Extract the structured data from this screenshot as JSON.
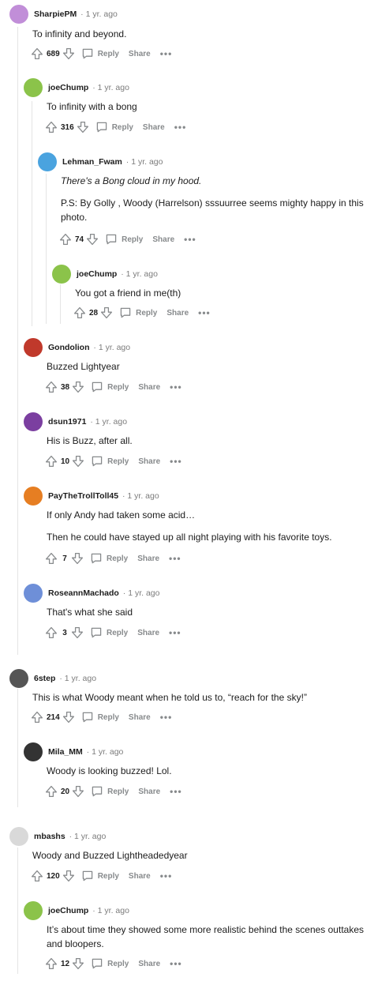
{
  "actions": {
    "reply": "Reply",
    "share": "Share",
    "more": "•••"
  },
  "comments": [
    {
      "user": "SharpiePM",
      "time": "· 1 yr. ago",
      "body": [
        "To infinity and beyond."
      ],
      "votes": "689",
      "avatar_color": "#c18ed8"
    },
    {
      "user": "joeChump",
      "time": "· 1 yr. ago",
      "body": [
        "To infinity with a bong"
      ],
      "votes": "316",
      "avatar_color": "#8bc34a"
    },
    {
      "user": "Lehman_Fwam",
      "time": "· 1 yr. ago",
      "body": [
        "There's a Bong cloud in my hood.",
        "P.S: By Golly , Woody (Harrelson) sssuurree seems mighty happy in this photo."
      ],
      "votes": "74",
      "avatar_color": "#4aa3df"
    },
    {
      "user": "joeChump",
      "time": "· 1 yr. ago",
      "body": [
        "You got a friend in me(th)"
      ],
      "votes": "28",
      "avatar_color": "#8bc34a"
    },
    {
      "user": "Gondolion",
      "time": "· 1 yr. ago",
      "body": [
        "Buzzed Lightyear"
      ],
      "votes": "38",
      "avatar_color": "#c0392b"
    },
    {
      "user": "dsun1971",
      "time": "· 1 yr. ago",
      "body": [
        "His is Buzz, after all."
      ],
      "votes": "10",
      "avatar_color": "#7b3fa0"
    },
    {
      "user": "PayTheTrollToll45",
      "time": "· 1 yr. ago",
      "body": [
        "If only Andy had taken some acid…",
        "Then he could have stayed up all night playing with his favorite toys."
      ],
      "votes": "7",
      "avatar_color": "#e67e22"
    },
    {
      "user": "RoseannMachado",
      "time": "· 1 yr. ago",
      "body": [
        "That's what she said"
      ],
      "votes": "3",
      "avatar_color": "#6e8fd8"
    },
    {
      "user": "6step",
      "time": "· 1 yr. ago",
      "body": [
        "This is what Woody meant when he told us to, “reach for the sky!”"
      ],
      "votes": "214",
      "avatar_color": "#555555"
    },
    {
      "user": "Mila_MM",
      "time": "· 1 yr. ago",
      "body": [
        "Woody is looking buzzed! Lol."
      ],
      "votes": "20",
      "avatar_color": "#333333"
    },
    {
      "user": "mbashs",
      "time": "· 1 yr. ago",
      "body": [
        "Woody and Buzzed Lightheadedyear"
      ],
      "votes": "120",
      "avatar_color": "#d9d9d9"
    },
    {
      "user": "joeChump",
      "time": "· 1 yr. ago",
      "body": [
        "It’s about time they showed some more realistic behind the scenes outtakes and bloopers."
      ],
      "votes": "12",
      "avatar_color": "#8bc34a"
    }
  ]
}
